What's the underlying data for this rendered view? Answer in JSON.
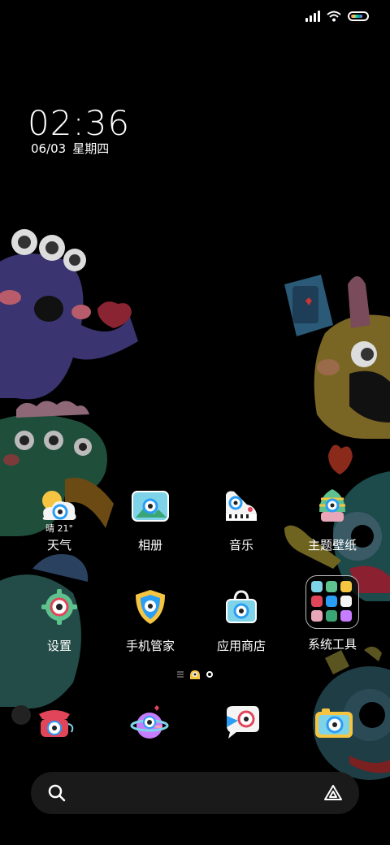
{
  "status_bar": {
    "battery_level": 0.8
  },
  "lockscreen": {
    "time": "02:36",
    "date": "06/03",
    "weekday": "星期四"
  },
  "weather": {
    "text": "晴 21°"
  },
  "apps": [
    {
      "label": "天气",
      "icon": "weather-icon"
    },
    {
      "label": "相册",
      "icon": "gallery-icon"
    },
    {
      "label": "音乐",
      "icon": "music-icon"
    },
    {
      "label": "主题壁纸",
      "icon": "themes-icon"
    },
    {
      "label": "设置",
      "icon": "settings-icon"
    },
    {
      "label": "手机管家",
      "icon": "security-icon"
    },
    {
      "label": "应用商店",
      "icon": "app-store-icon"
    },
    {
      "label": "系统工具",
      "icon": "folder-icon"
    }
  ],
  "dock": [
    {
      "icon": "phone-icon"
    },
    {
      "icon": "browser-icon"
    },
    {
      "icon": "messages-icon"
    },
    {
      "icon": "camera-icon"
    }
  ],
  "colors": {
    "accent": "#2a9df4",
    "search_bg": "#1a1a1a"
  }
}
